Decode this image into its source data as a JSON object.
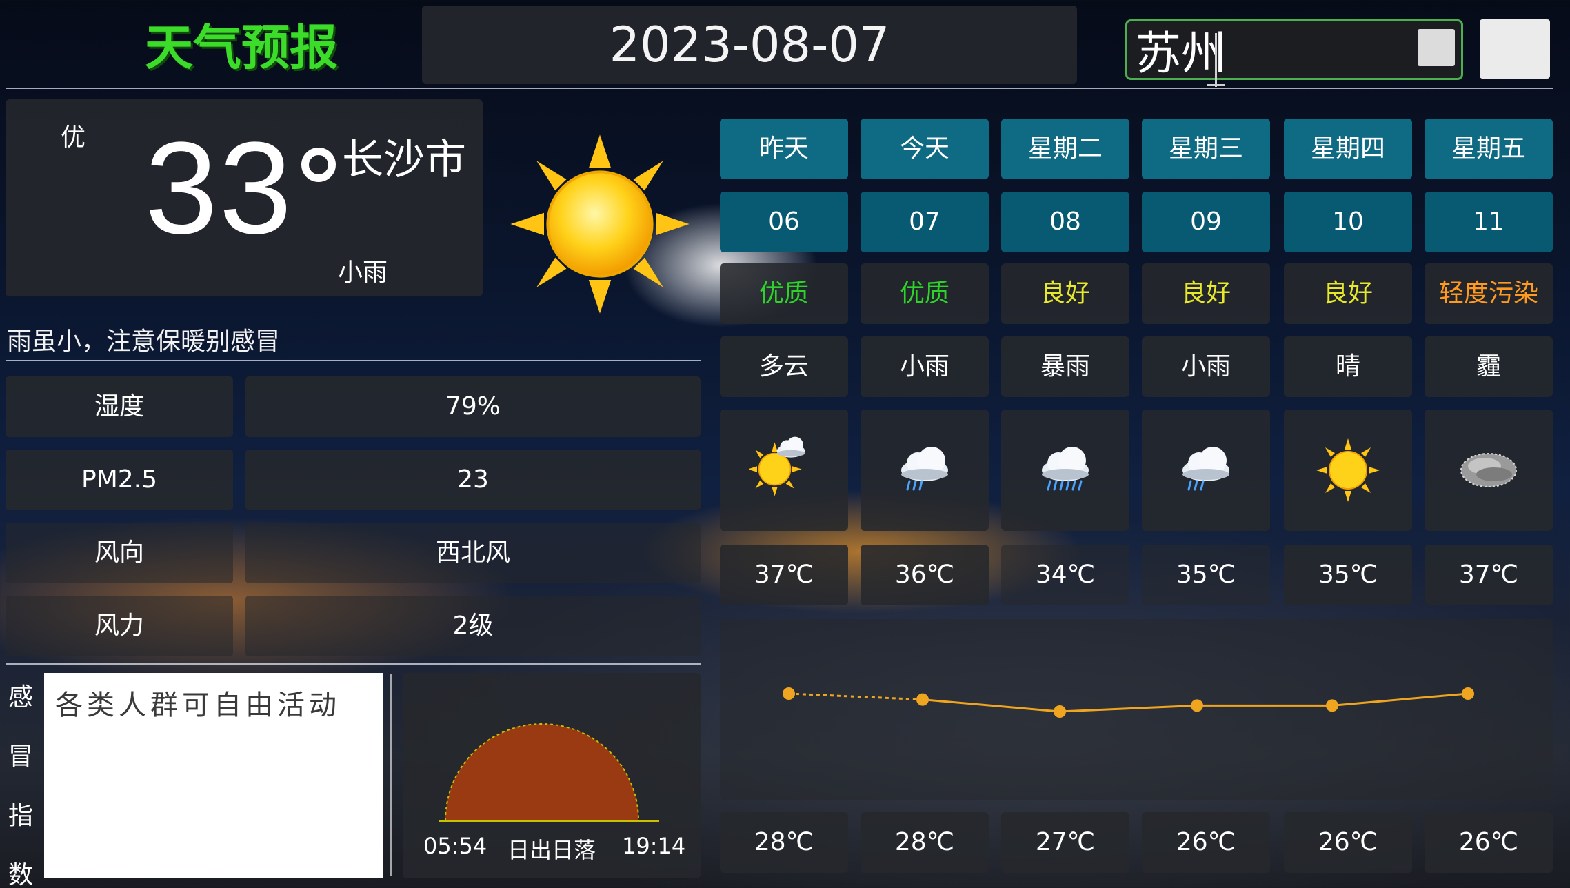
{
  "header": {
    "title": "天气预报",
    "date": "2023-08-07",
    "city_input_value": "苏州"
  },
  "current": {
    "aqi_level": "优",
    "temperature": "33",
    "city": "长沙市",
    "condition": "小雨",
    "icon": "sunny-icon",
    "tip": "雨虽小，注意保暖别感冒"
  },
  "details": [
    {
      "label": "湿度",
      "value": "79%"
    },
    {
      "label": "PM2.5",
      "value": "23"
    },
    {
      "label": "风向",
      "value": "西北风"
    },
    {
      "label": "风力",
      "value": "2级"
    }
  ],
  "life_index": {
    "label_chars": [
      "感",
      "冒",
      "指",
      "数"
    ],
    "text": "各类人群可自由活动"
  },
  "sun": {
    "sunrise": "05:54",
    "caption": "日出日落",
    "sunset": "19:14",
    "arc_color": "#9a3a12"
  },
  "forecast": [
    {
      "day": "昨天",
      "date": "06",
      "aqi": "优质",
      "aqi_color": "#2fd22a",
      "condition": "多云",
      "icon": "partly-cloudy-icon",
      "high": "37℃",
      "low": "28℃"
    },
    {
      "day": "今天",
      "date": "07",
      "aqi": "优质",
      "aqi_color": "#2fd22a",
      "condition": "小雨",
      "icon": "light-rain-icon",
      "high": "36℃",
      "low": "28℃"
    },
    {
      "day": "星期二",
      "date": "08",
      "aqi": "良好",
      "aqi_color": "#e8e82a",
      "condition": "暴雨",
      "icon": "heavy-rain-icon",
      "high": "34℃",
      "low": "27℃"
    },
    {
      "day": "星期三",
      "date": "09",
      "aqi": "良好",
      "aqi_color": "#e8e82a",
      "condition": "小雨",
      "icon": "light-rain-icon",
      "high": "35℃",
      "low": "26℃"
    },
    {
      "day": "星期四",
      "date": "10",
      "aqi": "良好",
      "aqi_color": "#e8e82a",
      "condition": "晴",
      "icon": "sunny-icon",
      "high": "35℃",
      "low": "26℃"
    },
    {
      "day": "星期五",
      "date": "11",
      "aqi": "轻度污染",
      "aqi_color": "#ff9a1e",
      "condition": "霾",
      "icon": "haze-icon",
      "high": "37℃",
      "low": "26℃"
    }
  ],
  "chart_data": {
    "type": "line",
    "categories": [
      "06",
      "07",
      "08",
      "09",
      "10",
      "11"
    ],
    "series": [
      {
        "values": [
          37,
          36,
          34,
          35,
          35,
          37
        ]
      }
    ],
    "color": "#f0a520",
    "dashed_segments": [
      0
    ]
  }
}
